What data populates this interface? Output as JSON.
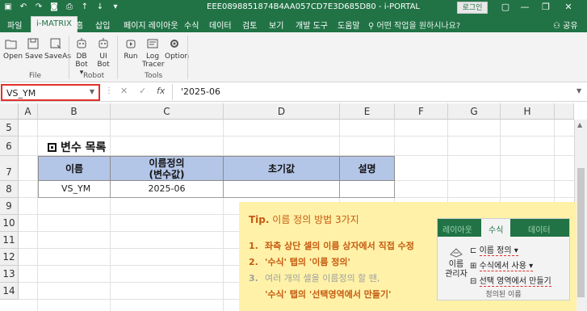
{
  "window": {
    "title": "EEE0898851874B4AA057CD7E3D685D80 - i-PORTAL",
    "login_label": "로그인",
    "controls": [
      "▢",
      "—",
      "❐",
      "✕"
    ]
  },
  "ribbon_tabs": [
    "파일",
    "i-MATRIX",
    "홈",
    "삽입",
    "페이지 레이아웃",
    "수식",
    "데이터",
    "검토",
    "보기",
    "개발 도구",
    "도움말"
  ],
  "tell_me": "어떤 작업을 원하시나요?",
  "share_label": "공유",
  "ribbon": {
    "file_group": {
      "label": "File",
      "buttons": [
        "Open",
        "Save",
        "SaveAs"
      ]
    },
    "robot_group": {
      "label": "Robot",
      "buttons": [
        [
          "DB",
          "Bot ▾"
        ],
        [
          "UI",
          "Bot"
        ]
      ]
    },
    "tools_group": {
      "label": "Tools",
      "buttons": [
        [
          "Run"
        ],
        [
          "Log",
          "Tracer"
        ],
        [
          "Option"
        ]
      ]
    }
  },
  "formula_bar": {
    "name_box": "VS_YM",
    "formula": "'2025-06",
    "cancel_icon": "✕",
    "enter_icon": "✓",
    "fx_icon": "fx"
  },
  "grid": {
    "columns": [
      "A",
      "B",
      "C",
      "D",
      "E",
      "F",
      "G",
      "H"
    ],
    "rows": [
      "5",
      "6",
      "7",
      "8",
      "9",
      "10",
      "11",
      "12",
      "13",
      "14"
    ]
  },
  "sheet": {
    "section_title": "변수 목록",
    "headers": [
      "이름",
      [
        "이름정의",
        "(변수값)"
      ],
      "초기값",
      "설명"
    ],
    "row": [
      "VS_YM",
      "2025-06",
      "",
      ""
    ]
  },
  "tip": {
    "title_prefix": "Tip.",
    "title_rest": "이름 정의 방법 3가지",
    "items": [
      {
        "num": "1.",
        "text": "좌측 상단 셀의 이름 상자에서 직접 수정"
      },
      {
        "num": "2.",
        "text": "'수식' 탭의 '이름 정의'"
      },
      {
        "num": "3.",
        "text": "여러 개의 셀을 이름정의 할 땐,"
      }
    ],
    "item3_cont": "'수식' 탭의 '선택영역에서 만들기'",
    "inset": {
      "tabs": [
        "레이아웃",
        "수식",
        "데이터"
      ],
      "big_button": [
        "이름",
        "관리자"
      ],
      "items": [
        "이름 정의 ▾",
        "수식에서 사용 ▾",
        "선택 영역에서 만들기"
      ],
      "group_label": "정의된 이름"
    }
  },
  "colors": {
    "excel_green": "#217346",
    "header_fill": "#b4c6e7",
    "tip_bg": "#fff2a8",
    "tip_text": "#c55a11",
    "highlight": "#e0302a"
  }
}
